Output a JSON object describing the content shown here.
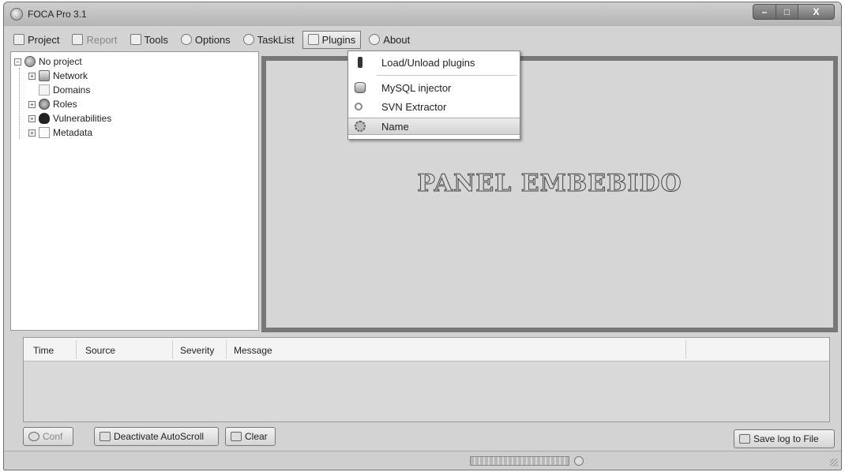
{
  "window": {
    "title": "FOCA Pro 3.1"
  },
  "menubar": {
    "project": "Project",
    "report": "Report",
    "tools": "Tools",
    "options": "Options",
    "tasklist": "TaskList",
    "plugins": "Plugins",
    "about": "About"
  },
  "tree": {
    "root": "No project",
    "network": "Network",
    "domains": "Domains",
    "roles": "Roles",
    "vulnerabilities": "Vulnerabilities",
    "metadata": "Metadata"
  },
  "plugins_menu": {
    "load_unload": "Load/Unload plugins",
    "mysql_injector": "MySQL injector",
    "svn_extractor": "SVN Extractor",
    "name": "Name"
  },
  "panel": {
    "text": "PANEL EMBEBIDO"
  },
  "log": {
    "columns": {
      "time": "Time",
      "source": "Source",
      "severity": "Severity",
      "message": "Message"
    }
  },
  "buttons": {
    "conf": "Conf",
    "deactivate_autoscroll": "Deactivate AutoScroll",
    "clear": "Clear",
    "save_log": "Save log to File"
  },
  "statusbar": {
    "progress": 1.0
  }
}
